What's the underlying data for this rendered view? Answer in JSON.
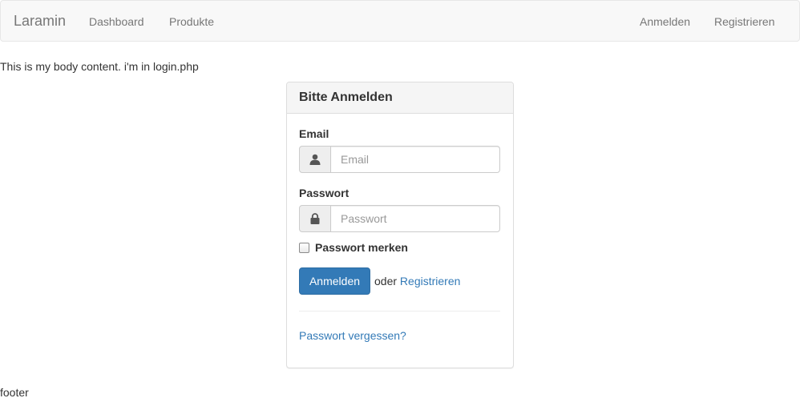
{
  "navbar": {
    "brand": "Laramin",
    "left_links": [
      "Dashboard",
      "Produkte"
    ],
    "right_links": [
      "Anmelden",
      "Registrieren"
    ]
  },
  "body_text": "This is my body content. i'm in login.php",
  "login_panel": {
    "title": "Bitte Anmelden",
    "email_label": "Email",
    "email_placeholder": "Email",
    "email_icon": "user-icon",
    "password_label": "Passwort",
    "password_placeholder": "Passwort",
    "password_icon": "lock-icon",
    "remember_label": "Passwort merken",
    "remember_checked": false,
    "submit_label": "Anmelden",
    "or_text": "oder",
    "register_link": "Registrieren",
    "forgot_link": "Passwort vergessen?"
  },
  "footer": "footer",
  "colors": {
    "primary": "#337ab7",
    "navbar_bg": "#f8f8f8",
    "nav_text": "#777777",
    "panel_heading_bg": "#f5f5f5"
  }
}
